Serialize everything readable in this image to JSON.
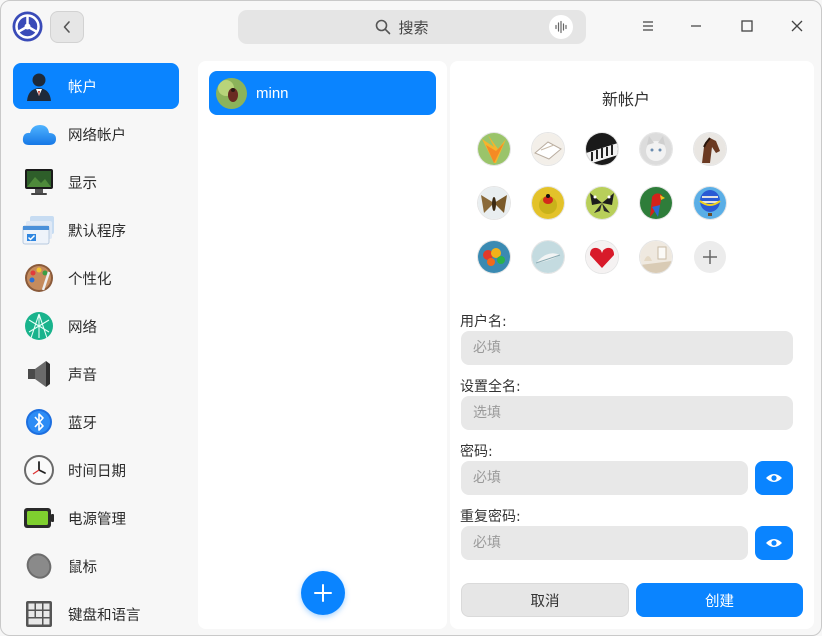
{
  "titlebar": {
    "search_placeholder": "搜索"
  },
  "sidebar": {
    "items": [
      {
        "label": "帐户",
        "icon": "user-account-icon",
        "active": true
      },
      {
        "label": "网络帐户",
        "icon": "cloud-icon"
      },
      {
        "label": "显示",
        "icon": "monitor-icon"
      },
      {
        "label": "默认程序",
        "icon": "default-apps-icon"
      },
      {
        "label": "个性化",
        "icon": "palette-icon"
      },
      {
        "label": "网络",
        "icon": "network-icon"
      },
      {
        "label": "声音",
        "icon": "speaker-icon"
      },
      {
        "label": "蓝牙",
        "icon": "bluetooth-icon"
      },
      {
        "label": "时间日期",
        "icon": "clock-icon"
      },
      {
        "label": "电源管理",
        "icon": "battery-icon"
      },
      {
        "label": "鼠标",
        "icon": "mouse-icon"
      },
      {
        "label": "键盘和语言",
        "icon": "keyboard-icon"
      }
    ]
  },
  "accounts": {
    "items": [
      {
        "name": "minn"
      }
    ]
  },
  "form": {
    "title": "新帐户",
    "avatars": [
      "flower",
      "paper",
      "piano",
      "kitten",
      "horse",
      "moth",
      "ladybug",
      "butterfly",
      "parrot",
      "balloon",
      "balloons",
      "feather",
      "heart",
      "room"
    ],
    "username_label": "用户名:",
    "username_placeholder": "必填",
    "fullname_label": "设置全名:",
    "fullname_placeholder": "选填",
    "password_label": "密码:",
    "password_placeholder": "必填",
    "repeat_label": "重复密码:",
    "repeat_placeholder": "必填",
    "cancel_label": "取消",
    "create_label": "创建"
  },
  "colors": {
    "accent": "#0a84ff",
    "panel": "#ffffff",
    "background": "#f7f7f7"
  }
}
